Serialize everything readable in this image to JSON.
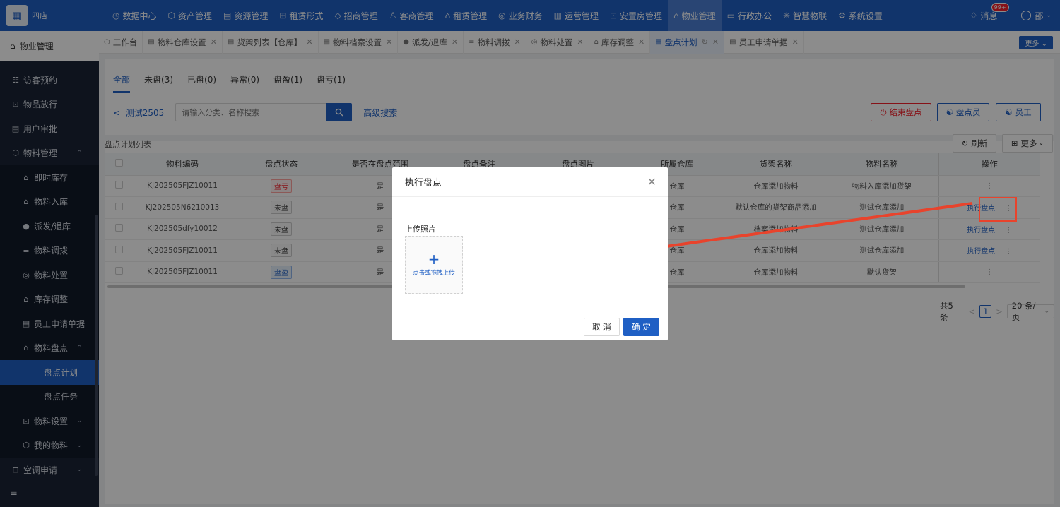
{
  "app": {
    "store_name": "四店",
    "logo_icon": "building-icon"
  },
  "top_nav": {
    "items": [
      {
        "label": "数据中心",
        "icon": "dashboard-icon"
      },
      {
        "label": "资产管理",
        "icon": "cube-icon"
      },
      {
        "label": "资源管理",
        "icon": "document-icon"
      },
      {
        "label": "租赁形式",
        "icon": "grid-icon"
      },
      {
        "label": "招商管理",
        "icon": "tag-icon"
      },
      {
        "label": "客商管理",
        "icon": "users-icon"
      },
      {
        "label": "租赁管理",
        "icon": "home-icon"
      },
      {
        "label": "业务财务",
        "icon": "finance-icon"
      },
      {
        "label": "运营管理",
        "icon": "chart-icon"
      },
      {
        "label": "安置房管理",
        "icon": "lock-icon"
      },
      {
        "label": "物业管理",
        "icon": "house-icon",
        "active": true
      },
      {
        "label": "行政办公",
        "icon": "monitor-icon"
      },
      {
        "label": "智慧物联",
        "icon": "network-icon"
      },
      {
        "label": "系统设置",
        "icon": "settings-icon"
      }
    ],
    "messages_label": "消息",
    "messages_badge": "99+",
    "user_name": "邵"
  },
  "sidebar": {
    "header": "物业管理",
    "items": [
      {
        "label": "访客预约",
        "level": 1
      },
      {
        "label": "物品放行",
        "level": 1
      },
      {
        "label": "用户审批",
        "level": 1
      },
      {
        "label": "物料管理",
        "level": 1,
        "expanded": true
      },
      {
        "label": "即时库存",
        "level": 2
      },
      {
        "label": "物料入库",
        "level": 2
      },
      {
        "label": "派发/退库",
        "level": 2
      },
      {
        "label": "物料调拨",
        "level": 2
      },
      {
        "label": "物料处置",
        "level": 2
      },
      {
        "label": "库存调整",
        "level": 2
      },
      {
        "label": "员工申请单据",
        "level": 2
      },
      {
        "label": "物料盘点",
        "level": 2,
        "expanded": true
      },
      {
        "label": "盘点计划",
        "level": 3,
        "active": true
      },
      {
        "label": "盘点任务",
        "level": 3
      },
      {
        "label": "物料设置",
        "level": 2,
        "collapsed": true
      },
      {
        "label": "我的物料",
        "level": 2,
        "collapsed": true
      },
      {
        "label": "空调申请",
        "level": 1,
        "collapsed": true
      }
    ]
  },
  "tabs": {
    "items": [
      {
        "label": "工作台",
        "closable": false
      },
      {
        "label": "物料仓库设置",
        "closable": true
      },
      {
        "label": "货架列表【仓库】",
        "closable": true
      },
      {
        "label": "物料档案设置",
        "closable": true
      },
      {
        "label": "派发/退库",
        "closable": true
      },
      {
        "label": "物料调拨",
        "closable": true
      },
      {
        "label": "物料处置",
        "closable": true
      },
      {
        "label": "库存调整",
        "closable": true
      },
      {
        "label": "盘点计划",
        "closable": true,
        "active": true
      },
      {
        "label": "员工申请单据",
        "closable": true
      }
    ],
    "more_label": "更多"
  },
  "main": {
    "sub_tabs": [
      "全部",
      "未盘(3)",
      "已盘(0)",
      "异常(0)",
      "盘盈(1)",
      "盘亏(1)"
    ],
    "back_label": "测试2505",
    "search_placeholder": "请输入分类、名称搜索",
    "advanced_search": "高级搜索",
    "end_button": "结束盘点",
    "counter_button": "盘点员",
    "staff_button": "员工",
    "list_title": "盘点计划列表",
    "refresh_label": "刷新",
    "more_label": "更多",
    "table": {
      "headers": [
        "物料编码",
        "盘点状态",
        "是否在盘点范围",
        "盘点备注",
        "盘点图片",
        "所属仓库",
        "货架名称",
        "物料名称",
        "操作"
      ],
      "rows": [
        {
          "code": "KJ202505FJZ10011",
          "status": "盘亏",
          "status_type": "red",
          "in_range": "是",
          "warehouse": "仓库",
          "shelf": "仓库添加物料",
          "name": "物料入库添加货架",
          "action": ""
        },
        {
          "code": "KJ202505N6210013",
          "status": "未盘",
          "status_type": "gray",
          "in_range": "是",
          "warehouse": "仓库",
          "shelf": "默认仓库的货架商品添加",
          "name": "测试仓库添加",
          "action": "执行盘点"
        },
        {
          "code": "KJ202505dfy10012",
          "status": "未盘",
          "status_type": "gray",
          "in_range": "是",
          "warehouse": "仓库",
          "shelf": "档案添加物料",
          "name": "测试仓库添加",
          "action": "执行盘点"
        },
        {
          "code": "KJ202505FJZ10011",
          "status": "未盘",
          "status_type": "gray",
          "in_range": "是",
          "warehouse": "仓库",
          "shelf": "仓库添加物料",
          "name": "测试仓库添加",
          "action": "执行盘点"
        },
        {
          "code": "KJ202505FJZ10011",
          "status": "盘盈",
          "status_type": "blue",
          "in_range": "是",
          "warehouse": "仓库",
          "shelf": "仓库添加物料",
          "name": "默认货架",
          "action": ""
        }
      ]
    },
    "pager": {
      "total": "共5条",
      "current": "1",
      "page_size": "20 条/页"
    }
  },
  "modal": {
    "title": "执行盘点",
    "upload_label": "上传照片",
    "upload_text": "点击或拖拽上传",
    "cancel_label": "取 消",
    "confirm_label": "确 定"
  },
  "colors": {
    "primary": "#1f5fc4",
    "sidebar_bg": "#1b2436",
    "danger": "#f5222d",
    "annotation": "#e8432c"
  }
}
